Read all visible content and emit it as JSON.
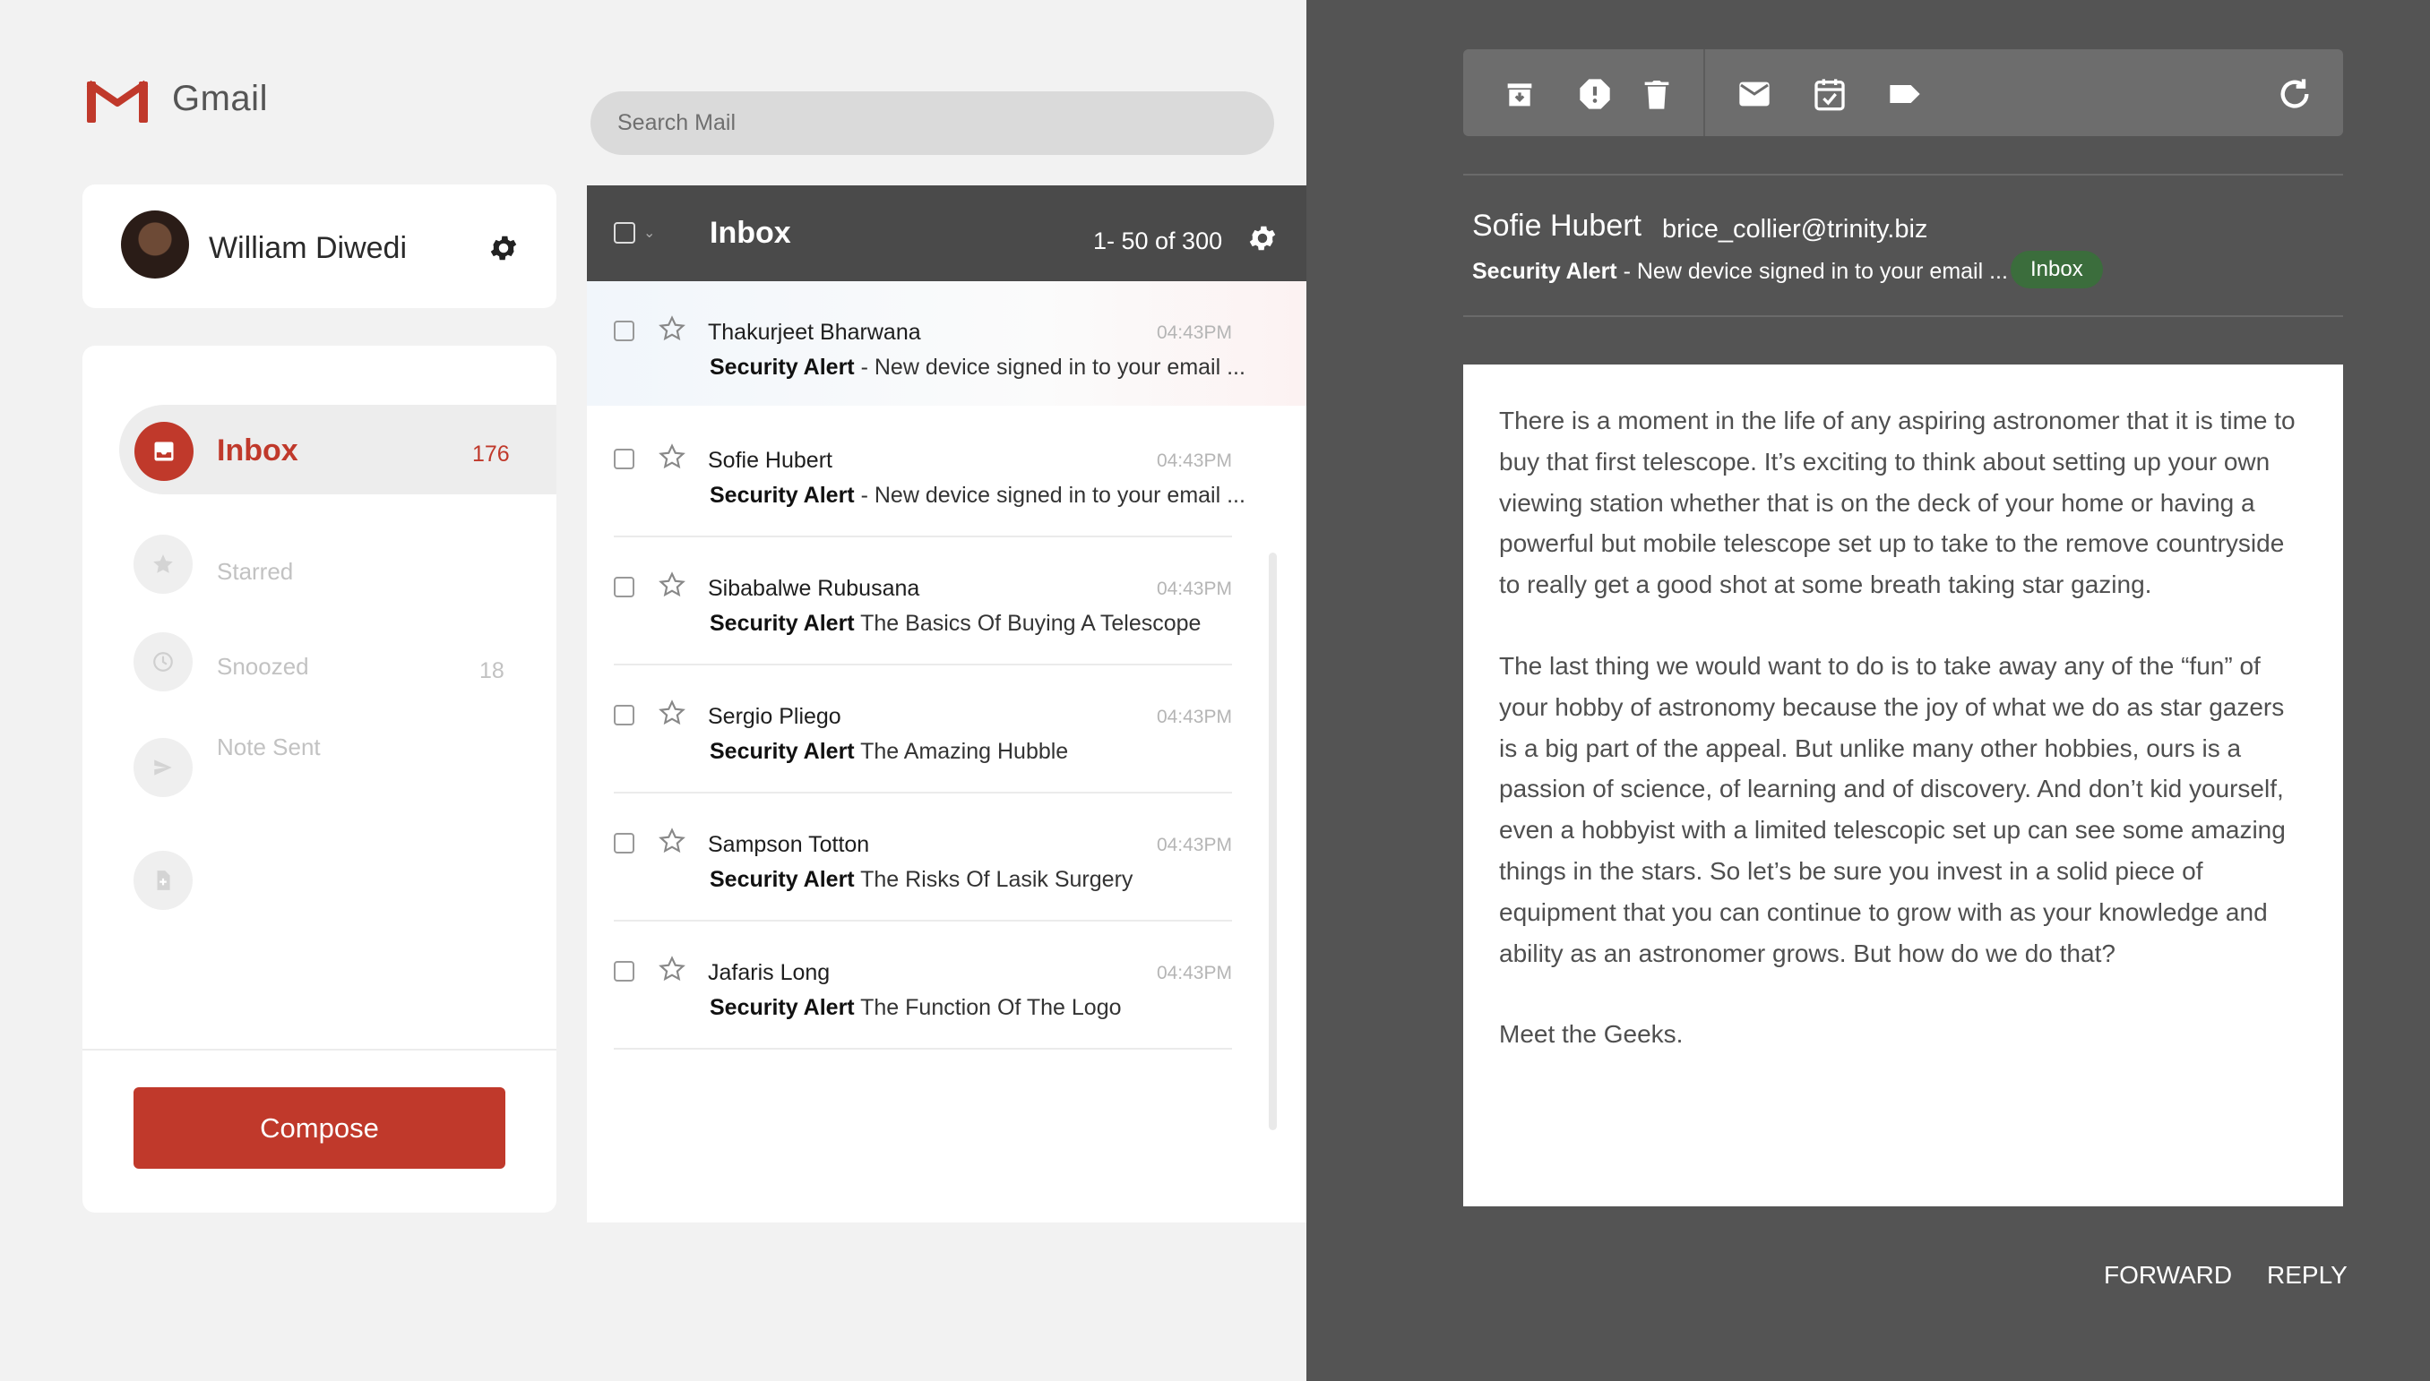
{
  "app": {
    "name": "Gmail"
  },
  "search": {
    "placeholder": "Search Mail"
  },
  "user": {
    "name": "William Diwedi"
  },
  "sidebar": {
    "items": [
      {
        "label": "Inbox",
        "count": "176",
        "icon": "inbox-icon",
        "active": true
      },
      {
        "label": "Starred",
        "count": "",
        "icon": "star-icon"
      },
      {
        "label": "Snoozed",
        "count": "18",
        "icon": "clock-icon"
      },
      {
        "label": "Note Sent",
        "count": "",
        "icon": "send-icon"
      },
      {
        "label": "",
        "count": "",
        "icon": "draft-icon"
      }
    ],
    "compose_label": "Compose"
  },
  "list": {
    "title": "Inbox",
    "pagination": "1- 50 of 300",
    "rows": [
      {
        "sender": "Thakurjeet Bharwana",
        "time": "04:43PM",
        "subject_bold": "Security Alert",
        "subject_rest": " - New device signed in to your email ..."
      },
      {
        "sender": "Sofie Hubert",
        "time": "04:43PM",
        "subject_bold": "Security Alert",
        "subject_rest": " - New device signed in to your email ..."
      },
      {
        "sender": "Sibabalwe Rubusana",
        "time": "04:43PM",
        "subject_bold": "Security Alert",
        "subject_rest": " The Basics Of Buying A Telescope"
      },
      {
        "sender": "Sergio Pliego",
        "time": "04:43PM",
        "subject_bold": "Security Alert",
        "subject_rest": " The Amazing Hubble"
      },
      {
        "sender": "Sampson Totton",
        "time": "04:43PM",
        "subject_bold": "Security Alert",
        "subject_rest": " The Risks Of Lasik Surgery"
      },
      {
        "sender": "Jafaris Long",
        "time": "04:43PM",
        "subject_bold": "Security Alert",
        "subject_rest": " The Function Of The Logo"
      }
    ]
  },
  "message": {
    "sender": "Sofie Hubert",
    "email": "brice_collier@trinity.biz",
    "subject_bold": "Security Alert",
    "subject_rest": " - New device signed in to your email ...",
    "label": "Inbox",
    "paragraphs": [
      "There is a moment in the life of any aspiring astronomer that it is time to buy that first telescope. It’s exciting to think about setting up your own viewing station whether that is on the deck of your home or having a powerful but mobile telescope set up to take to the remove countryside to really get a good shot at some breath taking star gazing.",
      "The last thing we would want to do is to take away any of the “fun” of your hobby of astronomy because the joy of what we do as star gazers is a big part of the appeal. But unlike many other hobbies, ours is a passion of science, of learning and of discovery. And don’t kid yourself, even a hobbyist with a limited telescopic set up can see some amazing things in the stars. So let’s be sure you invest in a solid piece of equipment that you can continue to grow with as your knowledge and ability as an astronomer grows. But how do we do that?",
      "Meet the Geeks."
    ],
    "forward_label": "FORWARD",
    "reply_label": "REPLY"
  },
  "toolbar": {
    "icons": [
      "archive-icon",
      "report-spam-icon",
      "delete-icon",
      "mail-icon",
      "calendar-check-icon",
      "label-icon",
      "refresh-icon"
    ]
  },
  "colors": {
    "accent": "#c0392b",
    "header_dark": "#4a4a4a",
    "reader_bg": "#545454",
    "badge_green": "#3b6d3c"
  }
}
